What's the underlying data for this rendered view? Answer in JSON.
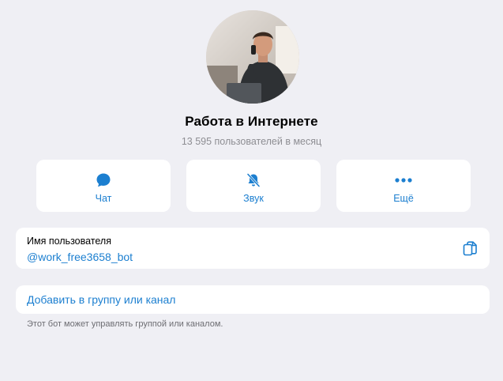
{
  "profile": {
    "name": "Работа в Интернете",
    "subscribers": "13 595 пользователей в месяц",
    "avatar_icon": "avatar-photo"
  },
  "actions": [
    {
      "label": "Чат",
      "icon": "chat-bubble-icon"
    },
    {
      "label": "Звук",
      "icon": "bell-muted-icon"
    },
    {
      "label": "Ещё",
      "icon": "more-dots-icon"
    }
  ],
  "username": {
    "label": "Имя пользователя",
    "value": "@work_free3658_bot",
    "icon": "copy-icon"
  },
  "add_to_group": {
    "label": "Добавить в группу или канал",
    "note": "Этот бот может управлять группой или каналом."
  },
  "colors": {
    "accent": "#1c7fd0",
    "background": "#efeff4",
    "card": "#ffffff",
    "secondary_text": "#8e8e93"
  }
}
